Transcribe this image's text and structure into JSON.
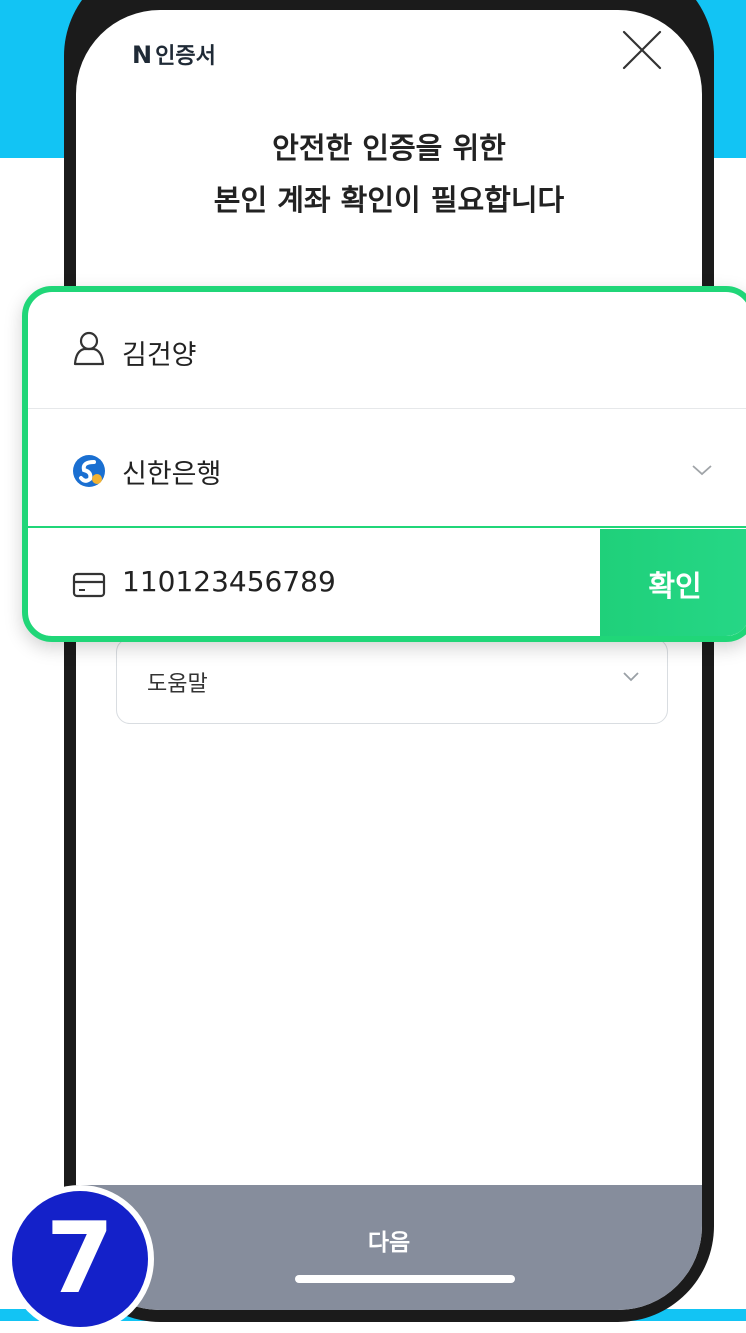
{
  "header": {
    "brand_mark": "N",
    "brand_name": "인증서",
    "close_icon": "close-icon"
  },
  "title": {
    "line1": "안전한 인증을 위한",
    "line2": "본인 계좌 확인이 필요합니다"
  },
  "form": {
    "name": {
      "icon": "person-icon",
      "value": "김건양"
    },
    "bank": {
      "icon": "shinhan-bank-logo-icon",
      "value": "신한은행",
      "chevron": "chevron-down-icon"
    },
    "account": {
      "icon": "card-icon",
      "value": "110123456789",
      "button_label": "확인"
    }
  },
  "help": {
    "label": "도움말",
    "chevron": "chevron-down-icon"
  },
  "footer": {
    "next_label": "다음"
  },
  "step_badge": {
    "number": "7"
  },
  "colors": {
    "background_accent": "#12c4f4",
    "highlight_green": "#20d678",
    "next_button": "#868d9c",
    "step_badge": "#1421c9"
  }
}
